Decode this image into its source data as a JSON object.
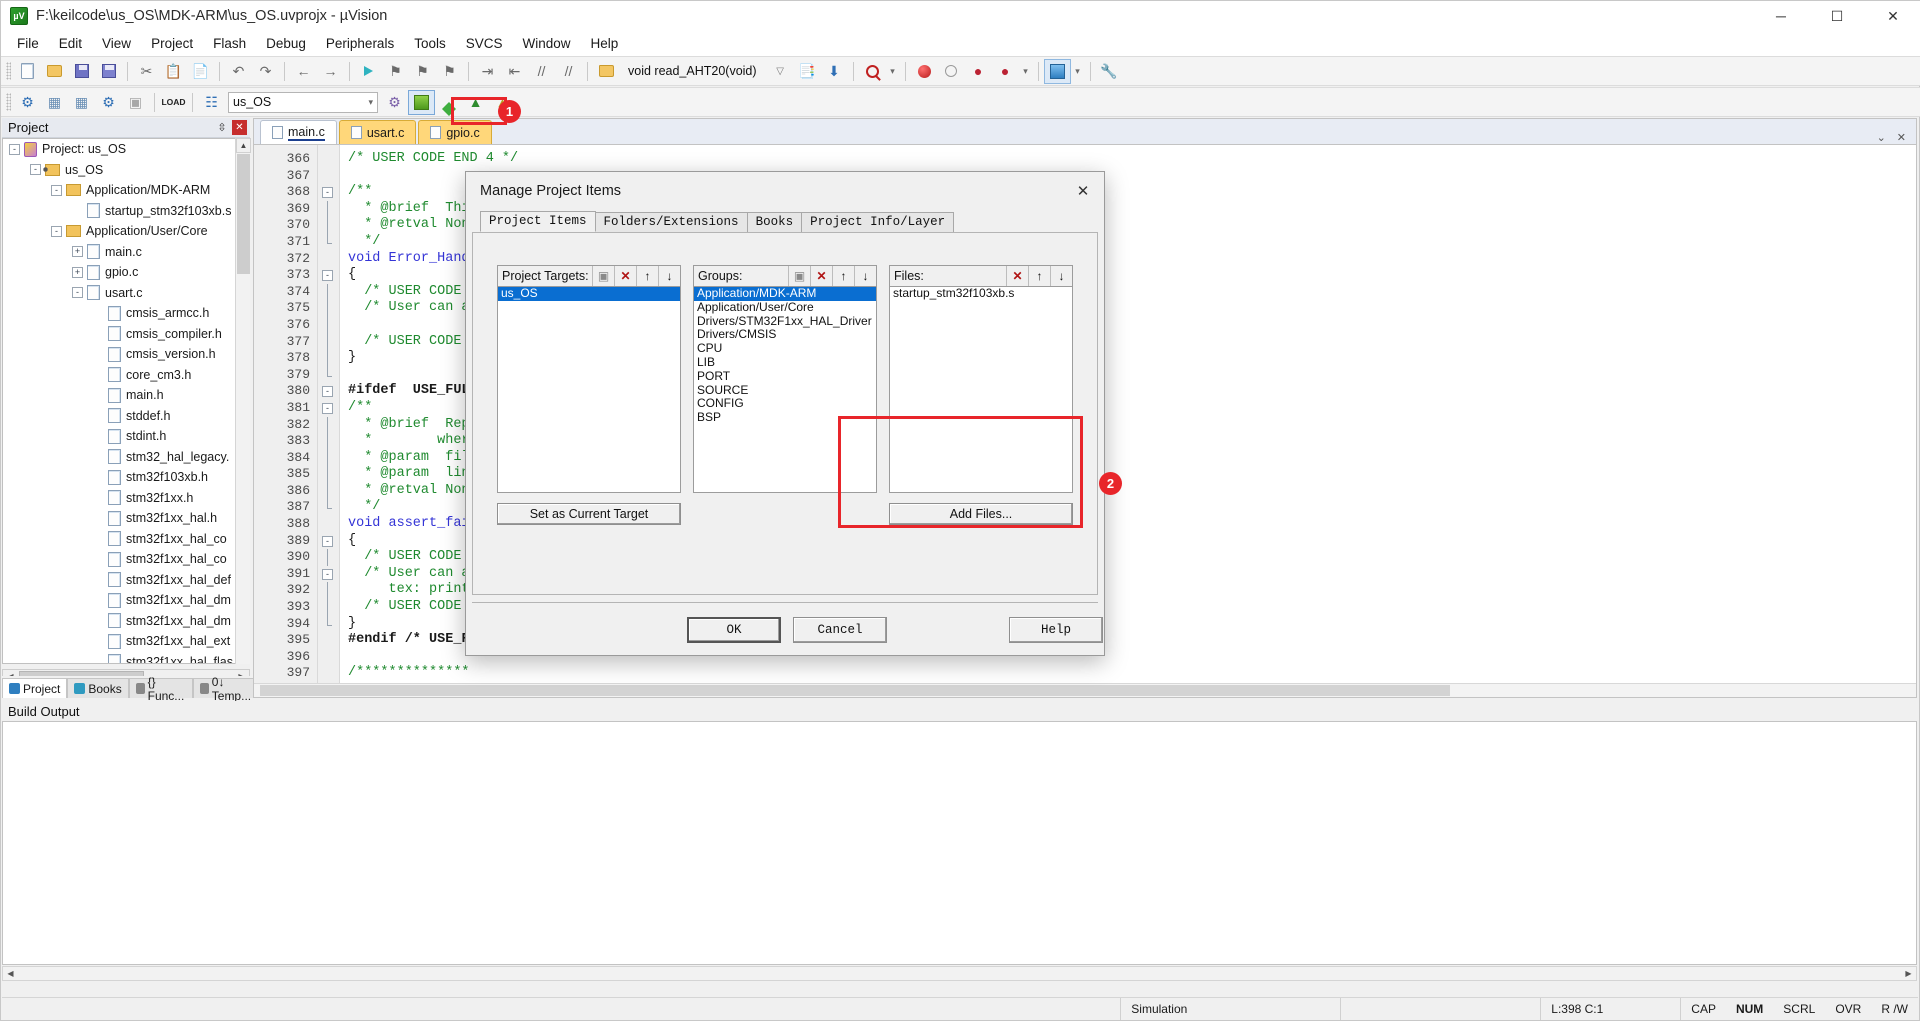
{
  "window": {
    "title": "F:\\keilcode\\us_OS\\MDK-ARM\\us_OS.uvprojx - µVision",
    "app_icon": "uvision-icon",
    "minimize": "─",
    "maximize": "☐",
    "close": "✕"
  },
  "menu": {
    "items": [
      "File",
      "Edit",
      "View",
      "Project",
      "Flash",
      "Debug",
      "Peripherals",
      "Tools",
      "SVCS",
      "Window",
      "Help"
    ]
  },
  "toolbar1": {
    "icons": [
      "new-file-icon",
      "open-file-icon",
      "save-icon",
      "save-all-icon",
      "cut-icon",
      "copy-icon",
      "paste-icon",
      "undo-icon",
      "redo-icon",
      "back-icon",
      "forward-icon",
      "bookmark-toggle-icon",
      "bookmark-prev-icon",
      "bookmark-next-icon",
      "bookmark-clear-icon",
      "indent-icon",
      "outdent-icon",
      "comment-icon",
      "uncomment-icon",
      "browse-icon"
    ],
    "function_combo_value": "void read_AHT20(void)",
    "caret": "⌄"
  },
  "toolbar2": {
    "target_combo_value": "us_OS",
    "caret": "⌄",
    "icons": [
      "translate-icon",
      "build-icon",
      "rebuild-icon",
      "batch-build-icon",
      "stop-build-icon",
      "load-icon",
      "manage-project-items-icon",
      "target-options-icon",
      "multi-project-icon",
      "pack-installer-icon"
    ],
    "load_label": "LOAD"
  },
  "project_panel": {
    "header": "Project",
    "pin": "⇳",
    "close": "✕",
    "tree": [
      {
        "label": "Project: us_OS",
        "depth": 0,
        "expander": "-",
        "icon": "project-icon"
      },
      {
        "label": "us_OS",
        "depth": 1,
        "expander": "-",
        "icon": "target-icon"
      },
      {
        "label": "Application/MDK-ARM",
        "depth": 2,
        "expander": "-",
        "icon": "folder-icon"
      },
      {
        "label": "startup_stm32f103xb.s",
        "depth": 3,
        "expander": "",
        "icon": "file-icon"
      },
      {
        "label": "Application/User/Core",
        "depth": 2,
        "expander": "-",
        "icon": "folder-icon"
      },
      {
        "label": "main.c",
        "depth": 3,
        "expander": "+",
        "icon": "file-icon"
      },
      {
        "label": "gpio.c",
        "depth": 3,
        "expander": "+",
        "icon": "file-icon"
      },
      {
        "label": "usart.c",
        "depth": 3,
        "expander": "-",
        "icon": "file-icon"
      },
      {
        "label": "cmsis_armcc.h",
        "depth": 4,
        "expander": "",
        "icon": "file-icon"
      },
      {
        "label": "cmsis_compiler.h",
        "depth": 4,
        "expander": "",
        "icon": "file-icon"
      },
      {
        "label": "cmsis_version.h",
        "depth": 4,
        "expander": "",
        "icon": "file-icon"
      },
      {
        "label": "core_cm3.h",
        "depth": 4,
        "expander": "",
        "icon": "file-icon"
      },
      {
        "label": "main.h",
        "depth": 4,
        "expander": "",
        "icon": "file-icon"
      },
      {
        "label": "stddef.h",
        "depth": 4,
        "expander": "",
        "icon": "file-icon"
      },
      {
        "label": "stdint.h",
        "depth": 4,
        "expander": "",
        "icon": "file-icon"
      },
      {
        "label": "stm32_hal_legacy.",
        "depth": 4,
        "expander": "",
        "icon": "file-icon"
      },
      {
        "label": "stm32f103xb.h",
        "depth": 4,
        "expander": "",
        "icon": "file-icon"
      },
      {
        "label": "stm32f1xx.h",
        "depth": 4,
        "expander": "",
        "icon": "file-icon"
      },
      {
        "label": "stm32f1xx_hal.h",
        "depth": 4,
        "expander": "",
        "icon": "file-icon"
      },
      {
        "label": "stm32f1xx_hal_co",
        "depth": 4,
        "expander": "",
        "icon": "file-icon"
      },
      {
        "label": "stm32f1xx_hal_co",
        "depth": 4,
        "expander": "",
        "icon": "file-icon"
      },
      {
        "label": "stm32f1xx_hal_def",
        "depth": 4,
        "expander": "",
        "icon": "file-icon"
      },
      {
        "label": "stm32f1xx_hal_dm",
        "depth": 4,
        "expander": "",
        "icon": "file-icon"
      },
      {
        "label": "stm32f1xx_hal_dm",
        "depth": 4,
        "expander": "",
        "icon": "file-icon"
      },
      {
        "label": "stm32f1xx_hal_ext",
        "depth": 4,
        "expander": "",
        "icon": "file-icon"
      },
      {
        "label": "stm32f1xx_hal_flas",
        "depth": 4,
        "expander": "",
        "icon": "file-icon"
      }
    ],
    "tabs": [
      {
        "label": "Project",
        "active": true,
        "icon": "project-tab-icon",
        "color": "#2f7fc0"
      },
      {
        "label": "Books",
        "active": false,
        "icon": "books-tab-icon",
        "color": "#2f9ac0"
      },
      {
        "label": "{} Func...",
        "active": false,
        "icon": "functions-tab-icon",
        "color": "#888888"
      },
      {
        "label": "0↓ Temp...",
        "active": false,
        "icon": "templates-tab-icon",
        "color": "#888888"
      }
    ]
  },
  "editor": {
    "tabs": [
      {
        "label": "main.c",
        "state": "active"
      },
      {
        "label": "usart.c",
        "state": "modified"
      },
      {
        "label": "gpio.c",
        "state": "modified"
      }
    ],
    "collapse": "⌄",
    "close": "✕",
    "first_line": 366,
    "lines": [
      {
        "n": 366,
        "fold": "",
        "text": "/* USER CODE END 4 */",
        "cls": "cm"
      },
      {
        "n": 367,
        "fold": "",
        "text": "",
        "cls": ""
      },
      {
        "n": 368,
        "fold": "-",
        "text": "/**",
        "cls": "cm"
      },
      {
        "n": 369,
        "fold": "|",
        "text": "  * @brief  This",
        "cls": "cm"
      },
      {
        "n": 370,
        "fold": "|",
        "text": "  * @retval None",
        "cls": "cm"
      },
      {
        "n": 371,
        "fold": "L",
        "text": "  */",
        "cls": "cm"
      },
      {
        "n": 372,
        "fold": "",
        "text": "void Error_Handl",
        "cls": "kw"
      },
      {
        "n": 373,
        "fold": "-",
        "text": "{",
        "cls": ""
      },
      {
        "n": 374,
        "fold": "|",
        "text": "  /* USER CODE B",
        "cls": "cm"
      },
      {
        "n": 375,
        "fold": "|",
        "text": "  /* User can ad",
        "cls": "cm"
      },
      {
        "n": 376,
        "fold": "|",
        "text": "",
        "cls": ""
      },
      {
        "n": 377,
        "fold": "|",
        "text": "  /* USER CODE E",
        "cls": "cm"
      },
      {
        "n": 378,
        "fold": "|",
        "text": "}",
        "cls": ""
      },
      {
        "n": 379,
        "fold": "L",
        "text": "",
        "cls": ""
      },
      {
        "n": 380,
        "fold": "-",
        "text": "#ifdef  USE_FULL",
        "cls": "pp"
      },
      {
        "n": 381,
        "fold": "-",
        "text": "/**",
        "cls": "cm"
      },
      {
        "n": 382,
        "fold": "|",
        "text": "  * @brief  Repo",
        "cls": "cm"
      },
      {
        "n": 383,
        "fold": "|",
        "text": "  *        wher",
        "cls": "cm"
      },
      {
        "n": 384,
        "fold": "|",
        "text": "  * @param  file",
        "cls": "cm"
      },
      {
        "n": 385,
        "fold": "|",
        "text": "  * @param  line",
        "cls": "cm"
      },
      {
        "n": 386,
        "fold": "|",
        "text": "  * @retval None",
        "cls": "cm"
      },
      {
        "n": 387,
        "fold": "L",
        "text": "  */",
        "cls": "cm"
      },
      {
        "n": 388,
        "fold": "",
        "text": "void assert_fail",
        "cls": "kw"
      },
      {
        "n": 389,
        "fold": "-",
        "text": "{",
        "cls": ""
      },
      {
        "n": 390,
        "fold": "|",
        "text": "  /* USER CODE B",
        "cls": "cm"
      },
      {
        "n": 391,
        "fold": "-",
        "text": "  /* User can ad",
        "cls": "cm"
      },
      {
        "n": 392,
        "fold": "|",
        "text": "     tex: printf",
        "cls": "cm"
      },
      {
        "n": 393,
        "fold": "|",
        "text": "  /* USER CODE E",
        "cls": "cm"
      },
      {
        "n": 394,
        "fold": "L",
        "text": "}",
        "cls": ""
      },
      {
        "n": 395,
        "fold": "",
        "text": "#endif /* USE_FU",
        "cls": "pp"
      },
      {
        "n": 396,
        "fold": "",
        "text": "",
        "cls": ""
      },
      {
        "n": 397,
        "fold": "",
        "text": "/**************",
        "cls": "cm"
      },
      {
        "n": 398,
        "fold": "",
        "text": "",
        "cls": ""
      }
    ]
  },
  "build_output": {
    "header": "Build Output",
    "content": "",
    "side_buttons": [
      "zoom-in-icon",
      "emoji-icon",
      "settings-icon"
    ]
  },
  "statusbar": {
    "left": "",
    "simulation": "Simulation",
    "position": "L:398 C:1",
    "caps": "CAP",
    "num": "NUM",
    "scrl": "SCRL",
    "ovr": "OVR",
    "rw": "R /W"
  },
  "dialog": {
    "title": "Manage Project Items",
    "close": "✕",
    "tabs": [
      {
        "label": "Project Items",
        "active": true
      },
      {
        "label": "Folders/Extensions",
        "active": false
      },
      {
        "label": "Books",
        "active": false
      },
      {
        "label": "Project Info/Layer",
        "active": false
      }
    ],
    "targets": {
      "label": "Project Targets:",
      "buttons": [
        "new-item-icon",
        "delete-icon",
        "move-up-icon",
        "move-down-icon"
      ],
      "new_glyph": "▣",
      "del_glyph": "✕",
      "up_glyph": "↑",
      "down_glyph": "↓",
      "items": [
        {
          "label": "us_OS",
          "selected": true
        }
      ],
      "action_button": "Set as Current Target"
    },
    "groups": {
      "label": "Groups:",
      "new_glyph": "▣",
      "del_glyph": "✕",
      "up_glyph": "↑",
      "down_glyph": "↓",
      "items": [
        {
          "label": "Application/MDK-ARM",
          "selected": true
        },
        {
          "label": "Application/User/Core",
          "selected": false
        },
        {
          "label": "Drivers/STM32F1xx_HAL_Driver",
          "selected": false
        },
        {
          "label": "Drivers/CMSIS",
          "selected": false
        },
        {
          "label": "CPU",
          "selected": false
        },
        {
          "label": "LIB",
          "selected": false
        },
        {
          "label": "PORT",
          "selected": false
        },
        {
          "label": "SOURCE",
          "selected": false
        },
        {
          "label": "CONFIG",
          "selected": false
        },
        {
          "label": "BSP",
          "selected": false
        }
      ]
    },
    "files": {
      "label": "Files:",
      "del_glyph": "✕",
      "up_glyph": "↑",
      "down_glyph": "↓",
      "items": [
        {
          "label": "startup_stm32f103xb.s",
          "selected": false
        }
      ],
      "action_button": "Add Files..."
    },
    "buttons": {
      "ok": "OK",
      "cancel": "Cancel",
      "help": "Help"
    }
  },
  "annotations": [
    {
      "id": "1",
      "kind": "badge",
      "label": "1"
    },
    {
      "id": "2",
      "kind": "badge",
      "label": "2"
    }
  ],
  "colors": {
    "accent_red": "#e8252a",
    "selection_blue": "#0a6ed1",
    "comment_green": "#1f8a2f",
    "keyword_blue": "#3434d6"
  }
}
